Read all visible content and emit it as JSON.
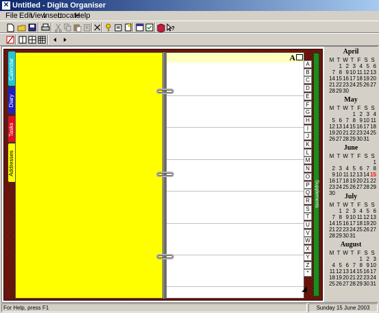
{
  "window": {
    "title": "Untitled - Digita Organiser"
  },
  "menu": {
    "items": [
      "File",
      "Edit",
      "View",
      "Insert",
      "Locate",
      "Help"
    ]
  },
  "toolbar1": {
    "icons": [
      "new-document-icon",
      "open-folder-icon",
      "save-disk-icon",
      "print-icon",
      "cut-icon",
      "copy-icon",
      "paste-icon",
      "paste-special-icon",
      "delete-x-icon",
      "find-key-icon",
      "open-note-icon",
      "bookmark-icon",
      "calendar-week-icon",
      "calendar-check-icon",
      "address-book-icon",
      "help-pointer-icon"
    ]
  },
  "toolbar2": {
    "icons": [
      "no-entry-icon",
      "single-page-view-icon",
      "double-page-view-icon",
      "grid-view-icon",
      "previous-arrow-icon",
      "next-arrow-icon"
    ]
  },
  "binder": {
    "tabs": [
      {
        "label": "Calendar",
        "color": "#20c8d0"
      },
      {
        "label": "Diary",
        "color": "#2020c0"
      },
      {
        "label": "Tasks",
        "color": "#e01020"
      },
      {
        "label": "Addresses",
        "color": "#ffff00"
      }
    ],
    "active_tab": "Addresses",
    "page_color": "#ffff00",
    "right_header_letter": "A",
    "alphabet": [
      "A",
      "B",
      "C",
      "D",
      "E",
      "F",
      "G",
      "H",
      "I",
      "J",
      "K",
      "L",
      "M",
      "N",
      "O",
      "P",
      "Q",
      "R",
      "S",
      "T",
      "U",
      "V",
      "W",
      "X",
      "Y",
      "Z",
      "*"
    ],
    "supplements_label": "Supplements",
    "supplements_color": "#1f8a1f"
  },
  "calendar": {
    "day_headers": [
      "M",
      "T",
      "W",
      "T",
      "F",
      "S",
      "S"
    ],
    "months": [
      {
        "name": "April",
        "weeks": [
          [
            "",
            "1",
            "2",
            "3",
            "4",
            "5",
            "6"
          ],
          [
            "7",
            "8",
            "9",
            "10",
            "11",
            "12",
            "13"
          ],
          [
            "14",
            "15",
            "16",
            "17",
            "18",
            "19",
            "20"
          ],
          [
            "21",
            "22",
            "23",
            "24",
            "25",
            "26",
            "27"
          ],
          [
            "28",
            "29",
            "30",
            "",
            "",
            "",
            ""
          ]
        ]
      },
      {
        "name": "May",
        "weeks": [
          [
            "",
            "",
            "",
            "1",
            "2",
            "3",
            "4"
          ],
          [
            "5",
            "6",
            "7",
            "8",
            "9",
            "10",
            "11"
          ],
          [
            "12",
            "13",
            "14",
            "15",
            "16",
            "17",
            "18"
          ],
          [
            "19",
            "20",
            "21",
            "22",
            "23",
            "24",
            "25"
          ],
          [
            "26",
            "27",
            "28",
            "29",
            "30",
            "31",
            ""
          ]
        ]
      },
      {
        "name": "June",
        "weeks": [
          [
            "",
            "",
            "",
            "",
            "",
            "",
            "1"
          ],
          [
            "2",
            "3",
            "4",
            "5",
            "6",
            "7",
            "8"
          ],
          [
            "9",
            "10",
            "11",
            "12",
            "13",
            "14",
            "15"
          ],
          [
            "16",
            "17",
            "18",
            "19",
            "20",
            "21",
            "22"
          ],
          [
            "23",
            "24",
            "25",
            "26",
            "27",
            "28",
            "29"
          ],
          [
            "30",
            "",
            "",
            "",
            "",
            "",
            ""
          ]
        ]
      },
      {
        "name": "July",
        "weeks": [
          [
            "",
            "1",
            "2",
            "3",
            "4",
            "5",
            "6"
          ],
          [
            "7",
            "8",
            "9",
            "10",
            "11",
            "12",
            "13"
          ],
          [
            "14",
            "15",
            "16",
            "17",
            "18",
            "19",
            "20"
          ],
          [
            "21",
            "22",
            "23",
            "24",
            "25",
            "26",
            "27"
          ],
          [
            "28",
            "29",
            "30",
            "31",
            "",
            "",
            ""
          ]
        ]
      },
      {
        "name": "August",
        "weeks": [
          [
            "",
            "",
            "",
            "",
            "1",
            "2",
            "3"
          ],
          [
            "4",
            "5",
            "6",
            "7",
            "8",
            "9",
            "10"
          ],
          [
            "11",
            "12",
            "13",
            "14",
            "15",
            "16",
            "17"
          ],
          [
            "18",
            "19",
            "20",
            "21",
            "22",
            "23",
            "24"
          ],
          [
            "25",
            "26",
            "27",
            "28",
            "29",
            "30",
            "31"
          ]
        ]
      }
    ],
    "today": {
      "month": "June",
      "day": "15"
    },
    "today_color": "#ff0000"
  },
  "status": {
    "left": "For Help, press F1",
    "right": "Sunday 15 June 2003"
  }
}
